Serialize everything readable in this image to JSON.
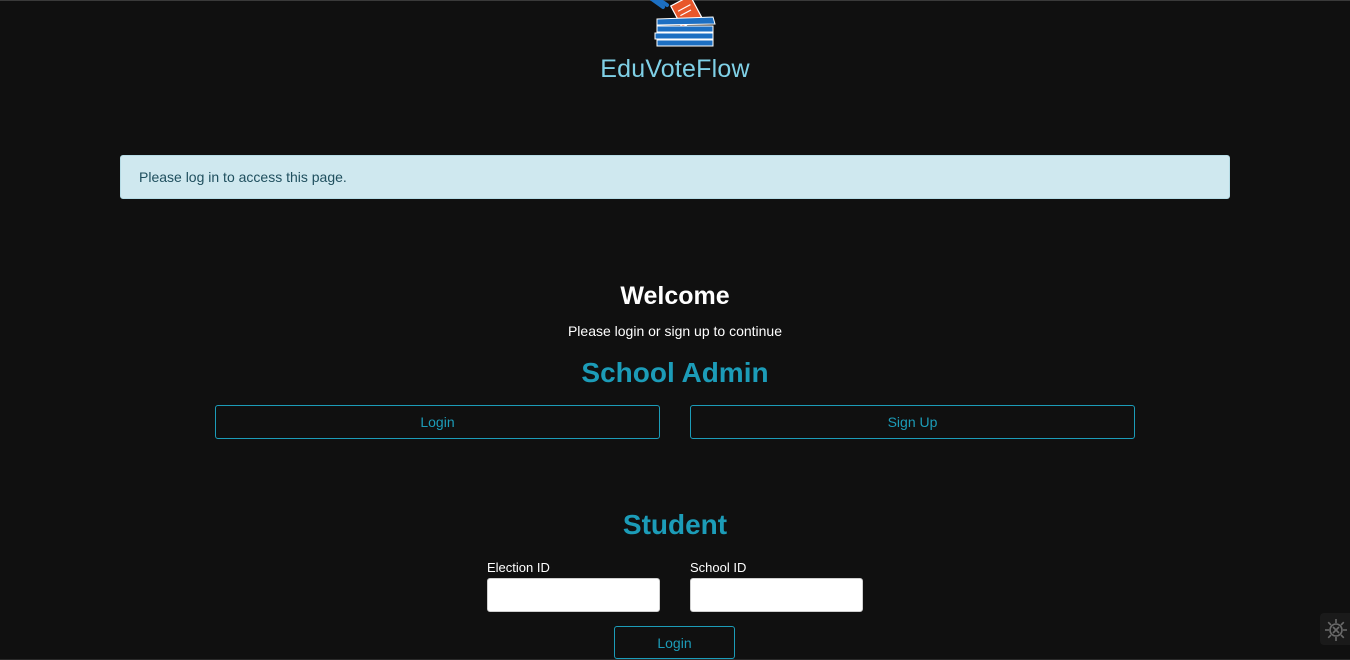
{
  "header": {
    "logo_icon": "ballot-box-icon",
    "brand": "EduVoteFlow"
  },
  "alert": {
    "message": "Please log in to access this page."
  },
  "welcome": {
    "title": "Welcome",
    "subtitle": "Please login or sign up to continue"
  },
  "school_admin": {
    "title": "School Admin",
    "login_label": "Login",
    "signup_label": "Sign Up"
  },
  "student": {
    "title": "Student",
    "election_id_label": "Election ID",
    "election_id_value": "",
    "school_id_label": "School ID",
    "school_id_value": "",
    "login_label": "Login"
  },
  "widgets": {
    "settings_icon": "gear-icon"
  },
  "colors": {
    "background": "#101010",
    "brand": "#7fd0e6",
    "accent": "#1c9cb8",
    "alert_bg": "#cfe8ef",
    "alert_text": "#1f4f5e"
  }
}
